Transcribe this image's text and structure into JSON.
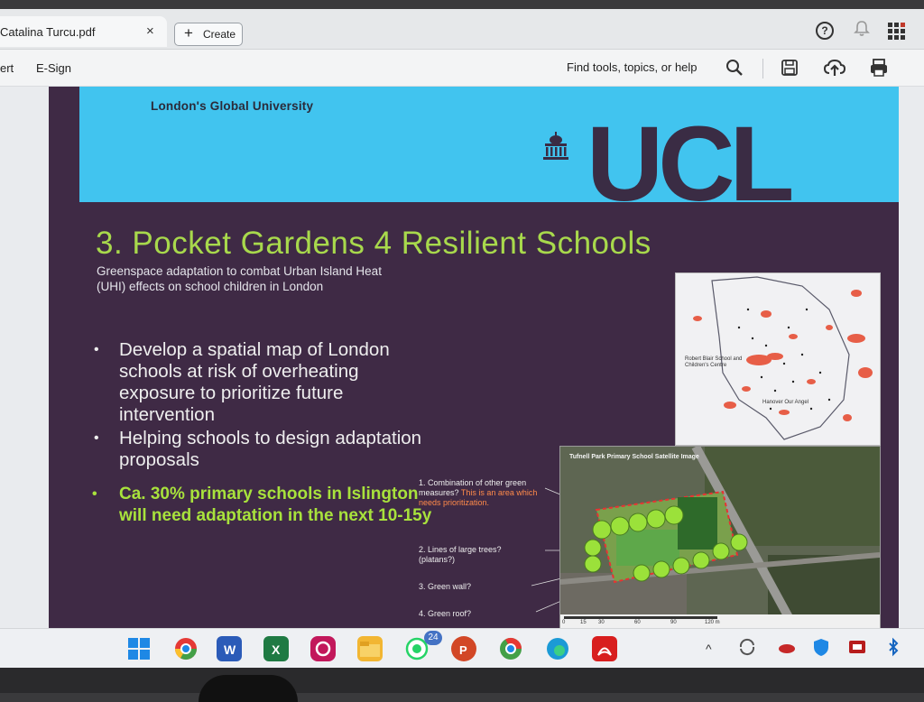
{
  "window": {
    "tab_title": "Catalina Turcu.pdf",
    "tab_close": "×",
    "create_label": "Create"
  },
  "toolbar": {
    "item_convert": "ert",
    "item_esign": "E-Sign",
    "find_tools": "Find tools, topics, or help"
  },
  "slide": {
    "university": "London's Global University",
    "logo_text": "UCL",
    "title": "3. Pocket Gardens 4 Resilient Schools",
    "subtitle": "Greenspace adaptation to combat Urban Island Heat (UHI) effects on school children in London",
    "bullets": [
      "Develop a spatial map of London schools at risk of overheating exposure to prioritize future intervention",
      "Helping schools to design adaptation proposals"
    ],
    "highlight": "Ca. 30% primary schools in Islington will need adaptation in the next 10-15y",
    "map_labels": [
      "Robert Blair School and Children's Centre",
      "Hanover Our Angel"
    ],
    "sat_title": "Tufnell Park Primary School Satellite Image",
    "annotations": {
      "a1": "1. Combination of other green measures?",
      "a1_note": "This is an area which needs prioritization.",
      "a2": "2. Lines of large trees? (platans?)",
      "a3": "3. Green wall?",
      "a4": "4. Green roof?"
    },
    "scale_ticks": [
      "0",
      "15",
      "30",
      "60",
      "90",
      "120 m"
    ]
  },
  "taskbar": {
    "whatsapp_badge": "24"
  },
  "colors": {
    "banner": "#41c4ef",
    "slide_bg": "#3f2a45",
    "title": "#a8d94c",
    "highlight": "#a8e23c",
    "note": "#ff8a4a"
  }
}
